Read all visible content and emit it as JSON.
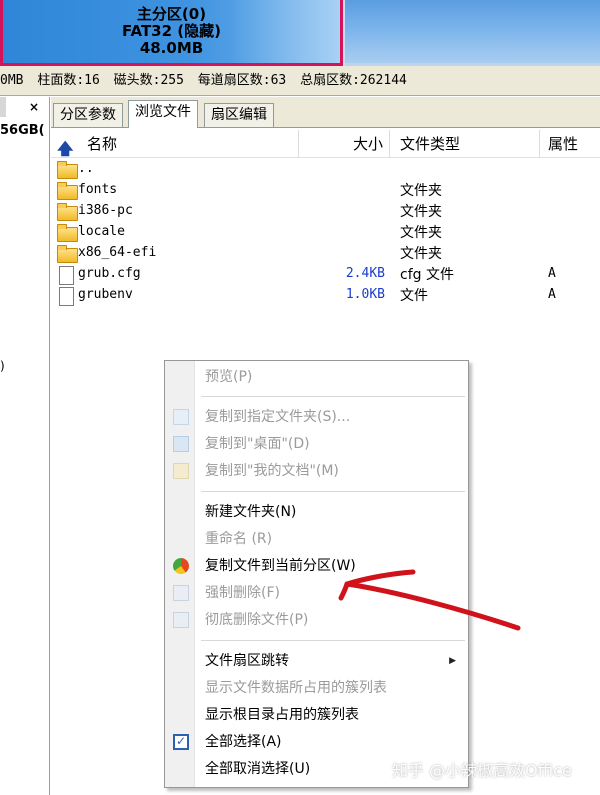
{
  "partitions": {
    "primary": {
      "title": "主分区(0)",
      "fs": "FAT32 (隐藏)",
      "size": "48.0MB"
    }
  },
  "status": {
    "size_suffix": "0MB",
    "cylinders": "柱面数:16",
    "heads": "磁头数:255",
    "sectors_per_track": "每道扇区数:63",
    "total_sectors": "总扇区数:262144"
  },
  "left_panel": {
    "close": "×",
    "disk_label": "56GB(",
    "marker": ")"
  },
  "tabs": [
    {
      "label": "分区参数"
    },
    {
      "label": "浏览文件"
    },
    {
      "label": "扇区编辑"
    }
  ],
  "file_list": {
    "columns": {
      "name": "名称",
      "size": "大小",
      "type": "文件类型",
      "attr": "属性"
    },
    "rows": [
      {
        "name": "..",
        "size": "",
        "type": "",
        "attr": "",
        "icon": "folder-icon"
      },
      {
        "name": "fonts",
        "size": "",
        "type": "文件夹",
        "attr": "",
        "icon": "folder-icon"
      },
      {
        "name": "i386-pc",
        "size": "",
        "type": "文件夹",
        "attr": "",
        "icon": "folder-icon"
      },
      {
        "name": "locale",
        "size": "",
        "type": "文件夹",
        "attr": "",
        "icon": "folder-icon"
      },
      {
        "name": "x86_64-efi",
        "size": "",
        "type": "文件夹",
        "attr": "",
        "icon": "folder-icon"
      },
      {
        "name": "grub.cfg",
        "size": "2.4KB",
        "type": "cfg 文件",
        "attr": "A",
        "icon": "file-icon"
      },
      {
        "name": "grubenv",
        "size": "1.0KB",
        "type": "文件",
        "attr": "A",
        "icon": "file-icon"
      }
    ]
  },
  "context_menu": {
    "items": [
      {
        "label": "预览(P)",
        "enabled": false
      },
      {
        "label": "复制到指定文件夹(S)...",
        "enabled": false,
        "icon": "copy-icon"
      },
      {
        "label": "复制到\"桌面\"(D)",
        "enabled": false,
        "icon": "desktop-icon"
      },
      {
        "label": "复制到\"我的文档\"(M)",
        "enabled": false,
        "icon": "documents-icon"
      },
      {
        "label": "新建文件夹(N)",
        "enabled": true
      },
      {
        "label": "重命名 (R)",
        "enabled": false
      },
      {
        "label": "复制文件到当前分区(W)",
        "enabled": true,
        "icon": "partition-pie-icon"
      },
      {
        "label": "强制删除(F)",
        "enabled": false,
        "icon": "delete-icon"
      },
      {
        "label": "彻底删除文件(P)",
        "enabled": false,
        "icon": "wipe-icon"
      },
      {
        "label": "文件扇区跳转",
        "enabled": true,
        "submenu": true
      },
      {
        "label": "显示文件数据所占用的簇列表",
        "enabled": false
      },
      {
        "label": "显示根目录占用的簇列表",
        "enabled": true
      },
      {
        "label": "全部选择(A)",
        "enabled": true,
        "icon": "select-all-check-icon"
      },
      {
        "label": "全部取消选择(U)",
        "enabled": true
      }
    ]
  },
  "colors": {
    "annotation": "#d0121b",
    "partition_border": "#d4145a",
    "size_text": "#1a3ccc"
  },
  "watermark": "知乎 @小辣椒高效Office"
}
